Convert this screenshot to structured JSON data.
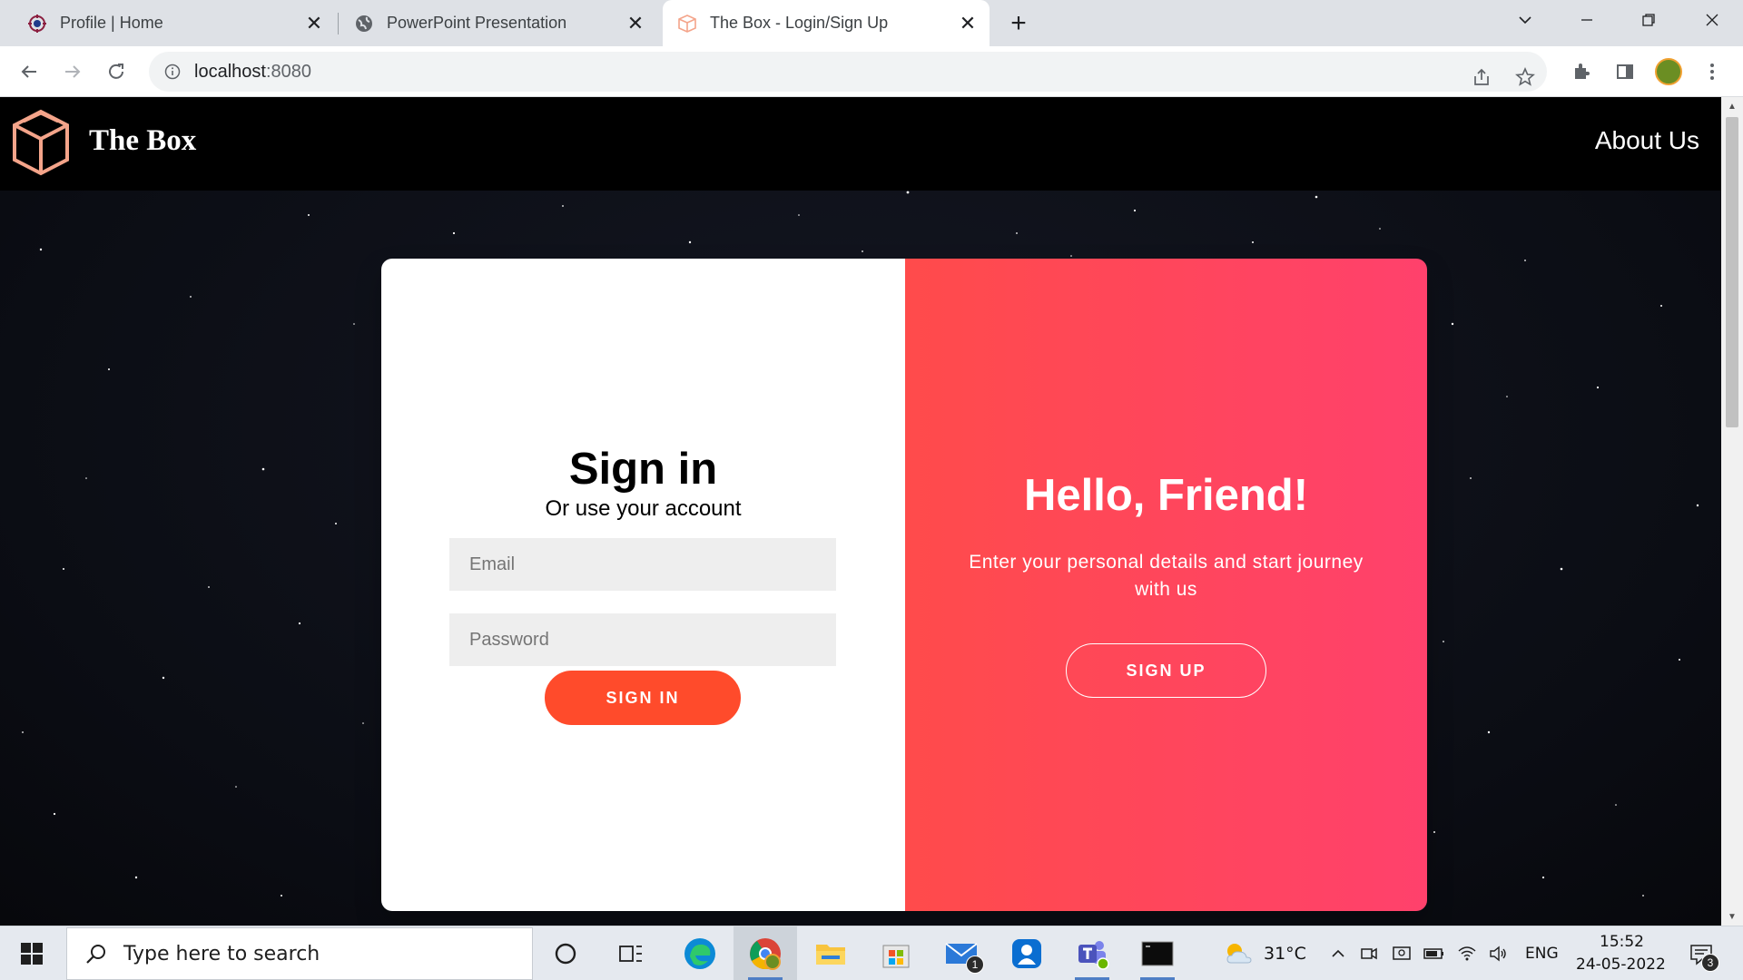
{
  "browser": {
    "tabs": [
      {
        "title": "Profile | Home",
        "favicon": "target-icon"
      },
      {
        "title": "PowerPoint Presentation",
        "favicon": "globe-icon"
      },
      {
        "title": "The Box - Login/Sign Up",
        "favicon": "box-logo-icon",
        "active": true
      }
    ],
    "address": {
      "host": "localhost",
      "port": ":8080"
    }
  },
  "site": {
    "brand": "The Box",
    "nav_about": "About Us"
  },
  "signin": {
    "title": "Sign in",
    "subtitle": "Or use your account",
    "email_placeholder": "Email",
    "password_placeholder": "Password",
    "button": "Sign In"
  },
  "overlay": {
    "title": "Hello, Friend!",
    "text": "Enter your personal details and start journey with us",
    "button": "Sign Up"
  },
  "taskbar": {
    "search_placeholder": "Type here to search",
    "weather": "31°C",
    "language": "ENG",
    "time": "15:52",
    "date": "24-05-2022",
    "mail_badge": "1",
    "notification_badge": "3"
  },
  "colors": {
    "accent": "#ff4b2b",
    "overlay_start": "#ff4b4b",
    "overlay_end": "#ff416c"
  }
}
